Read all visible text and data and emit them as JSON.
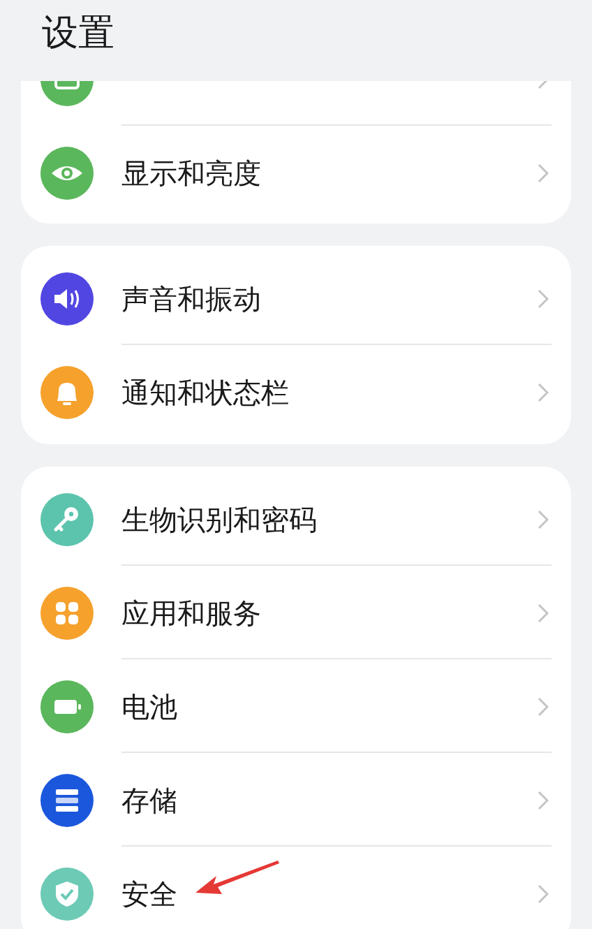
{
  "title": "设置",
  "groups": [
    {
      "partial": true,
      "items": [
        {
          "color": "#5bb75c"
        },
        {
          "color": "#5bb75c",
          "label": "显示和亮度"
        }
      ]
    },
    {
      "partial": false,
      "items": [
        {
          "color": "#5146e2",
          "label": "声音和振动"
        },
        {
          "color": "#f5a12c",
          "label": "通知和状态栏"
        }
      ]
    },
    {
      "partial": false,
      "items": [
        {
          "color": "#5cc4ad",
          "label": "生物识别和密码"
        },
        {
          "color": "#f5a12c",
          "label": "应用和服务"
        },
        {
          "color": "#5bb75c",
          "label": "电池"
        },
        {
          "color": "#1b57dc",
          "label": "存储"
        },
        {
          "color": "#6ccab5",
          "label": "安全",
          "annotated": true
        }
      ]
    }
  ]
}
